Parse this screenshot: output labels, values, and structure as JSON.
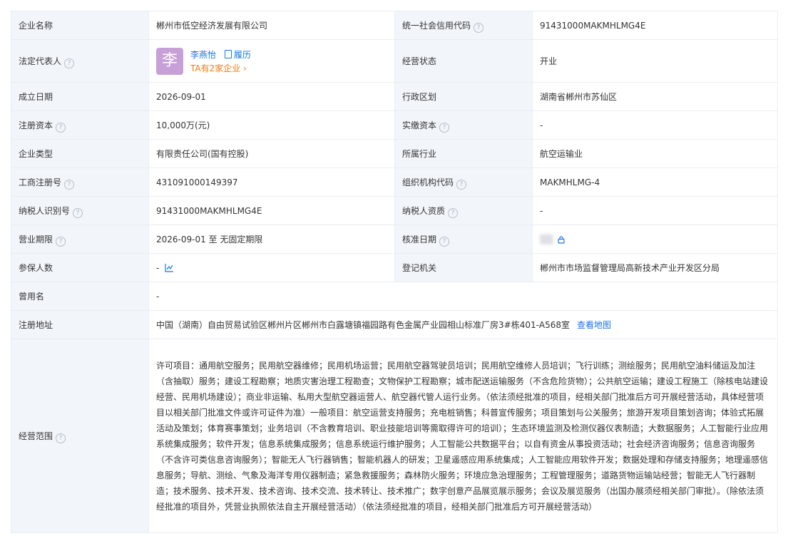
{
  "rows": {
    "company_name": {
      "label": "企业名称",
      "value": "郴州市低空经济发展有限公司"
    },
    "credit_code": {
      "label": "统一社会信用代码",
      "value": "91431000MAKMHLMG4E"
    },
    "legal_rep": {
      "label": "法定代表人",
      "name": "李燕怡",
      "avatar_char": "李",
      "resume": "履历",
      "companies": "TA有2家企业",
      "companies_arrow": "›"
    },
    "status": {
      "label": "经营状态",
      "value": "开业"
    },
    "founded": {
      "label": "成立日期",
      "value": "2026-09-01"
    },
    "region": {
      "label": "行政区划",
      "value": "湖南省郴州市苏仙区"
    },
    "reg_capital": {
      "label": "注册资本",
      "value": "10,000万(元)"
    },
    "paid_capital": {
      "label": "实缴资本",
      "value": "-"
    },
    "company_type": {
      "label": "企业类型",
      "value": "有限责任公司(国有控股)"
    },
    "industry": {
      "label": "所属行业",
      "value": "航空运输业"
    },
    "reg_no": {
      "label": "工商注册号",
      "value": "431091000149397"
    },
    "org_code": {
      "label": "组织机构代码",
      "value": "MAKMHLMG-4"
    },
    "taxpayer_id": {
      "label": "纳税人识别号",
      "value": "91431000MAKMHLMG4E"
    },
    "taxpayer_qual": {
      "label": "纳税人资质",
      "value": "-"
    },
    "term": {
      "label": "营业期限",
      "value": "2026-09-01 至 无固定期限"
    },
    "approval_date": {
      "label": "核准日期"
    },
    "insured": {
      "label": "参保人数",
      "value": "-"
    },
    "registrar": {
      "label": "登记机关",
      "value": "郴州市市场监督管理局高新技术产业开发区分局"
    },
    "former_name": {
      "label": "曾用名",
      "value": "-"
    },
    "address": {
      "label": "注册地址",
      "value": "中国（湖南）自由贸易试验区郴州片区郴州市白露塘镇福园路有色金属产业园相山标准厂房3#栋401-A568室",
      "map_link": "查看地图"
    },
    "scope": {
      "label": "经营范围",
      "value": "许可项目：通用航空服务；民用航空器维修；民用机场运营；民用航空器驾驶员培训；民用航空维修人员培训；飞行训练；测绘服务；民用航空油料储运及加注（含抽取）服务；建设工程勘察；地质灾害治理工程勘查；文物保护工程勘察；城市配送运输服务（不含危险货物）；公共航空运输；建设工程施工（除核电站建设经营、民用机场建设）；商业非运输、私用大型航空器运营人、航空器代管人运行业务。（依法须经批准的项目，经相关部门批准后方可开展经营活动，具体经营项目以相关部门批准文件或许可证件为准）一般项目：航空运营支持服务；充电桩销售；科普宣传服务；项目策划与公关服务；旅游开发项目策划咨询；体验式拓展活动及策划；体育赛事策划；业务培训（不含教育培训、职业技能培训等需取得许可的培训）；生态环境监测及检测仪器仪表制造；大数据服务；人工智能行业应用系统集成服务；软件开发；信息系统集成服务；信息系统运行维护服务；人工智能公共数据平台；以自有资金从事投资活动；社会经济咨询服务；信息咨询服务（不含许可类信息咨询服务）；智能无人飞行器销售；智能机器人的研发；卫星遥感应用系统集成；人工智能应用软件开发；数据处理和存储支持服务；地理遥感信息服务；导航、测绘、气象及海洋专用仪器制造；紧急救援服务；森林防火服务；环境应急治理服务；工程管理服务；道路货物运输站经营；智能无人飞行器制造；技术服务、技术开发、技术咨询、技术交流、技术转让、技术推广；数字创意产品展览展示服务；会议及展览服务（出国办展须经相关部门审批）。（除依法须经批准的项目外，凭营业执照依法自主开展经营活动）（依法须经批准的项目，经相关部门批准后方可开展经营活动）"
    }
  },
  "icons": {
    "help": "question-circle-icon",
    "chart": "line-chart-icon",
    "lock": "lock-icon",
    "resume": "document-icon"
  },
  "colors": {
    "label_bg": "#f2f6fb",
    "border": "#e9edf3",
    "link": "#1a74e8",
    "orange": "#f07b1b",
    "avatar": "#c7a0d8"
  }
}
